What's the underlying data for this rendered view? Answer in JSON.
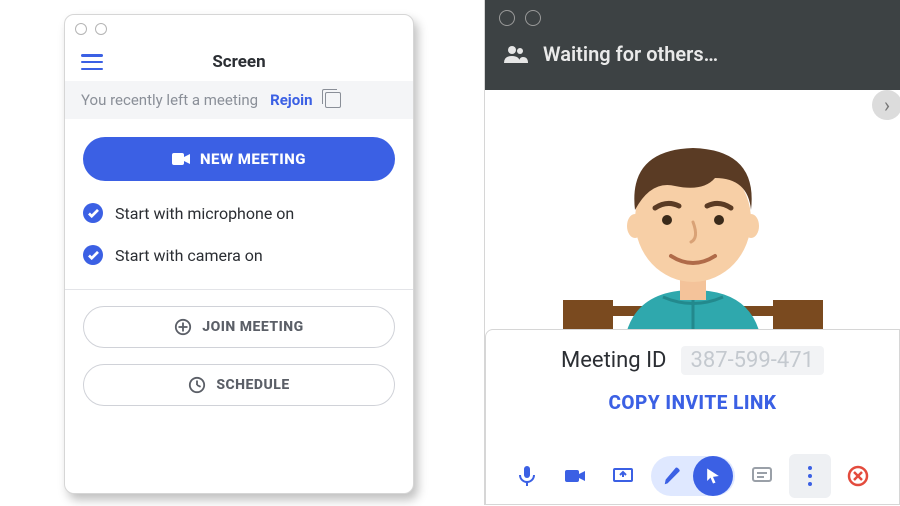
{
  "left": {
    "title": "Screen",
    "rejoin": {
      "message": "You recently left a meeting",
      "action": "Rejoin"
    },
    "newMeeting": "NEW MEETING",
    "options": {
      "mic": "Start with microphone on",
      "cam": "Start with camera on"
    },
    "join": "JOIN MEETING",
    "schedule": "SCHEDULE"
  },
  "right": {
    "status": "Waiting for others…",
    "meeting": {
      "label": "Meeting ID",
      "value": "387-599-471"
    },
    "copyLink": "COPY INVITE LINK"
  },
  "colors": {
    "accent": "#3B60E4",
    "danger": "#e34b3d"
  }
}
